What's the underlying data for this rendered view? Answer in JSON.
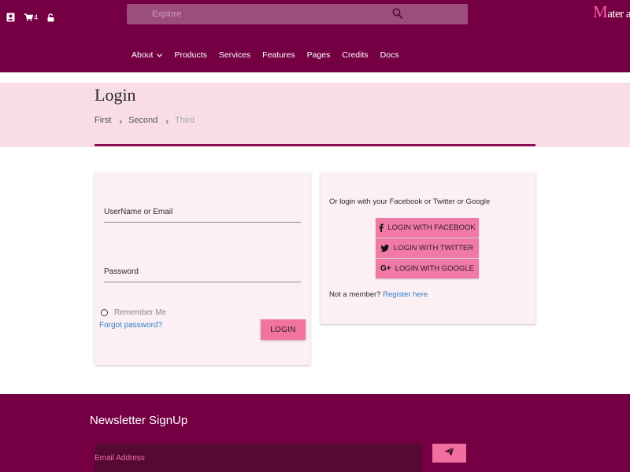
{
  "header": {
    "cart_count": "4",
    "search": {
      "placeholder": "Explore"
    },
    "logo": {
      "first_letter": "M",
      "rest": "ater aized"
    },
    "nav": [
      {
        "label": "About",
        "has_dropdown": true
      },
      {
        "label": "Products"
      },
      {
        "label": "Services"
      },
      {
        "label": "Features"
      },
      {
        "label": "Pages"
      },
      {
        "label": "Credits"
      },
      {
        "label": "Docs"
      }
    ]
  },
  "page": {
    "title": "Login",
    "breadcrumb": [
      "First",
      "Second",
      "Third"
    ]
  },
  "login_form": {
    "username_label": "UserName or Email",
    "password_label": "Password",
    "remember_label": "Remember Me",
    "forgot_label": "Forgot password?",
    "login_button": "LOGIN"
  },
  "social": {
    "intro": "Or login with your Facebook or Twitter or Google",
    "facebook": "LOGIN WITH FACEBOOK",
    "twitter": "LOGIN WITH TWITTER",
    "google": "LOGIN WITH GOOGLE",
    "not_member": "Not a member?",
    "register": "Register here"
  },
  "footer": {
    "newsletter_title": "Newsletter SignUp",
    "email_placeholder": "Email Address"
  },
  "colors": {
    "primary": "#740043",
    "accent": "#f0749e",
    "band": "#f8dde9",
    "card": "#fcf0f5",
    "link": "#2d7ec8"
  }
}
